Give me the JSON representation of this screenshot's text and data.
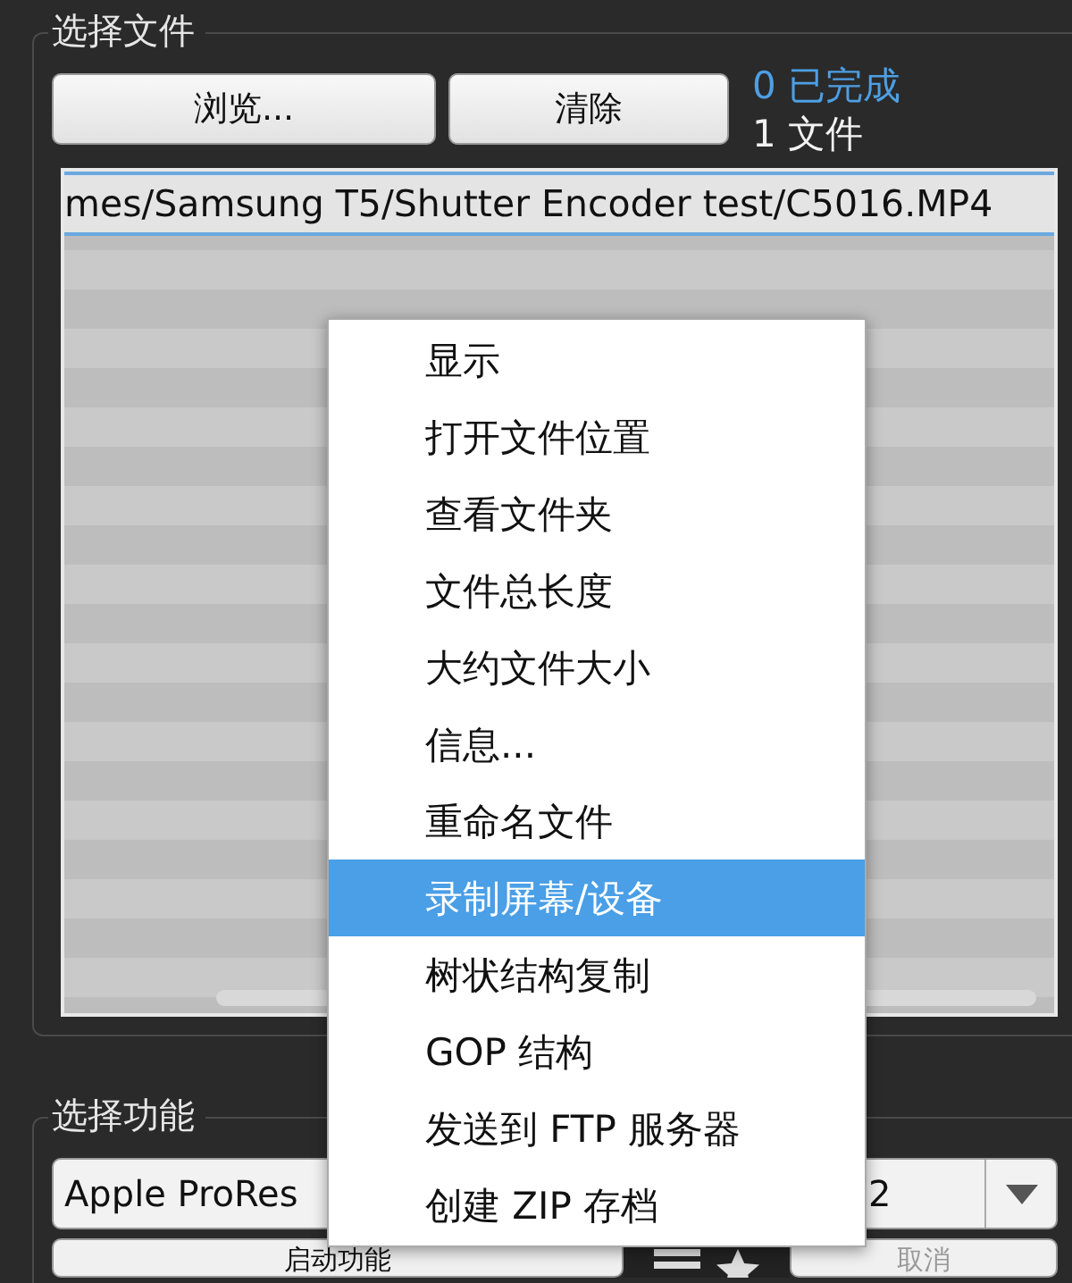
{
  "file_group": {
    "title": "选择文件",
    "buttons": [
      "浏览...",
      "清除"
    ],
    "completed": "0 已完成",
    "file_count": "1 文件",
    "files": [
      {
        "path": "mes/Samsung T5/Shutter Encoder test/C5016.MP4",
        "selected": true
      }
    ]
  },
  "function_group": {
    "title": "选择功能",
    "function": "Apple ProRes",
    "profile": "2",
    "start_button": "启动功能",
    "cancel_button": "取消"
  },
  "context_menu": [
    {
      "label": "显示",
      "selected": false
    },
    {
      "label": "打开文件位置",
      "selected": false
    },
    {
      "label": "查看文件夹",
      "selected": false
    },
    {
      "label": "文件总长度",
      "selected": false
    },
    {
      "label": "大约文件大小",
      "selected": false
    },
    {
      "label": "信息...",
      "selected": false
    },
    {
      "label": "重命名文件",
      "selected": false
    },
    {
      "label": "录制屏幕/设备",
      "selected": true
    },
    {
      "label": "树状结构复制",
      "selected": false
    },
    {
      "label": "GOP 结构",
      "selected": false
    },
    {
      "label": "发送到 FTP 服务器",
      "selected": false
    },
    {
      "label": "创建 ZIP 存档",
      "selected": false
    }
  ]
}
